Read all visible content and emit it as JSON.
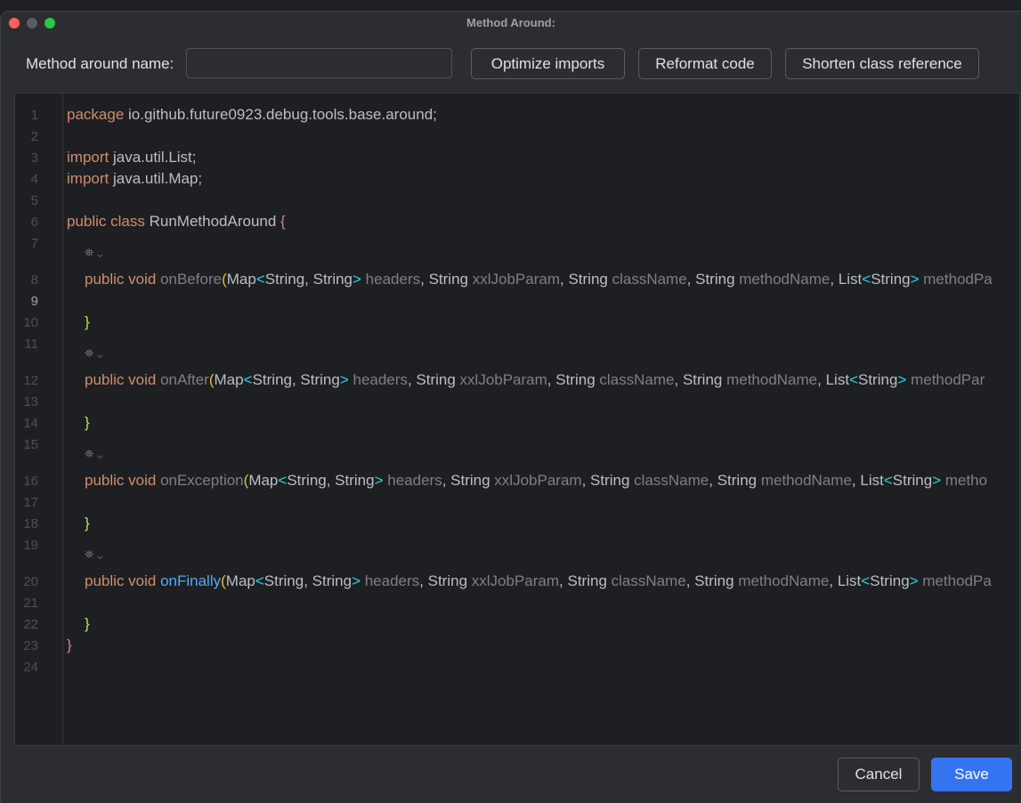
{
  "window": {
    "title": "Method Around:"
  },
  "toolbar": {
    "name_label": "Method around name:",
    "name_value": "",
    "optimize_label": "Optimize imports",
    "reformat_label": "Reformat code",
    "shorten_label": "Shorten class reference"
  },
  "editor": {
    "active_line": 9,
    "line_numbers": [
      "1",
      "2",
      "3",
      "4",
      "5",
      "6",
      "7",
      "8",
      "9",
      "10",
      "11",
      "12",
      "13",
      "14",
      "15",
      "16",
      "17",
      "18",
      "19",
      "20",
      "21",
      "22",
      "23",
      "24"
    ],
    "hint_glyph": "⛯ ⌄",
    "code": {
      "l1_kw": "package",
      "l1_rest": " io.github.future0923.debug.tools.base.around;",
      "l3_kw": "import",
      "l3_rest": " java.util.List;",
      "l4_kw": "import",
      "l4_rest": " java.util.Map;",
      "l6_kw": "public class",
      "l6_name": " RunMethodAround ",
      "l6_brace": "{",
      "l8_kw": "public void",
      "l8_name": "onBefore",
      "l12_kw": "public void",
      "l12_name": "onAfter",
      "l16_kw": "public void",
      "l16_name": "onException",
      "l20_kw": "public void",
      "l20_name": "onFinally",
      "param_open": "(",
      "p_map": "Map",
      "p_lt": "<",
      "p_ss": "String, String",
      "p_gt": ">",
      "p_headers": " headers",
      "p_comma": ", ",
      "p_string": "String",
      "p_xxl": " xxlJobParam",
      "p_class": " className",
      "p_method": " methodName",
      "p_list": "List",
      "p_s": "String",
      "p_methodpa": " methodPa",
      "p_methodpar": " methodPar",
      "p_metho": " metho",
      "close_brace": "}",
      "class_close": "}"
    }
  },
  "footer": {
    "cancel_label": "Cancel",
    "save_label": "Save"
  },
  "colors": {
    "keyword": "#cf8e6d",
    "method_gray": "#7c8087",
    "method_blue": "#56a8f5",
    "angle_brackets": "#2fd3e6",
    "save_button": "#3574f0"
  }
}
